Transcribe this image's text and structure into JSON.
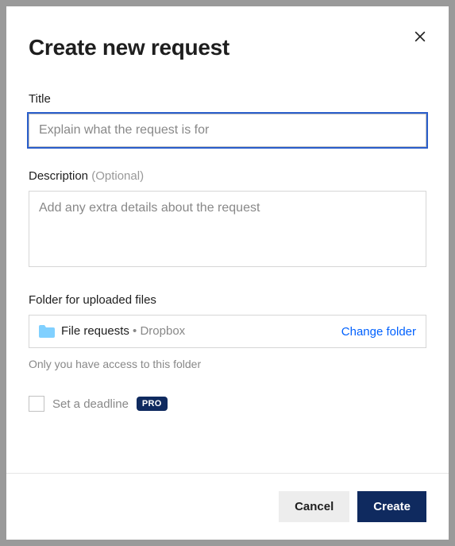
{
  "modal": {
    "title": "Create new request",
    "title_field": {
      "label": "Title",
      "placeholder": "Explain what the request is for",
      "value": ""
    },
    "description_field": {
      "label": "Description",
      "optional": "(Optional)",
      "placeholder": "Add any extra details about the request",
      "value": ""
    },
    "folder_field": {
      "label": "Folder for uploaded files",
      "folder_name": "File requests",
      "separator": " • ",
      "path": "Dropbox",
      "change_label": "Change folder"
    },
    "access_note": "Only you have access to this folder",
    "deadline": {
      "checked": false,
      "label": "Set a deadline",
      "badge": "PRO"
    },
    "footer": {
      "cancel": "Cancel",
      "create": "Create"
    }
  }
}
